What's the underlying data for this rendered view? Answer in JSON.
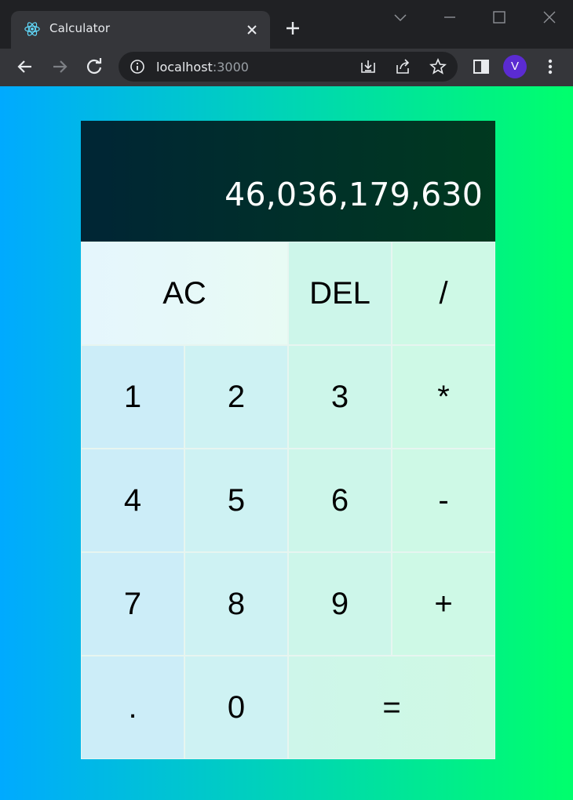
{
  "browser": {
    "tab_title": "Calculator",
    "url_host": "localhost",
    "url_port": ":3000",
    "avatar_letter": "V"
  },
  "calculator": {
    "display": "46,036,179,630",
    "keys": [
      "AC",
      "DEL",
      "/",
      "1",
      "2",
      "3",
      "*",
      "4",
      "5",
      "6",
      "-",
      "7",
      "8",
      "9",
      "+",
      ".",
      "0",
      "="
    ]
  },
  "colors": {
    "background_gradient": [
      "#00aaff",
      "#00ff6c"
    ],
    "display_gradient": [
      "#002535",
      "#00391f"
    ],
    "avatar": "#5b2bd1"
  },
  "icons": [
    "react-favicon",
    "close-icon",
    "plus-icon",
    "chevron-down-icon",
    "minimize-icon",
    "maximize-icon",
    "window-close-icon",
    "back-arrow-icon",
    "forward-arrow-icon",
    "reload-icon",
    "info-icon",
    "install-icon",
    "share-icon",
    "star-icon",
    "side-panel-icon",
    "more-vert-icon"
  ]
}
